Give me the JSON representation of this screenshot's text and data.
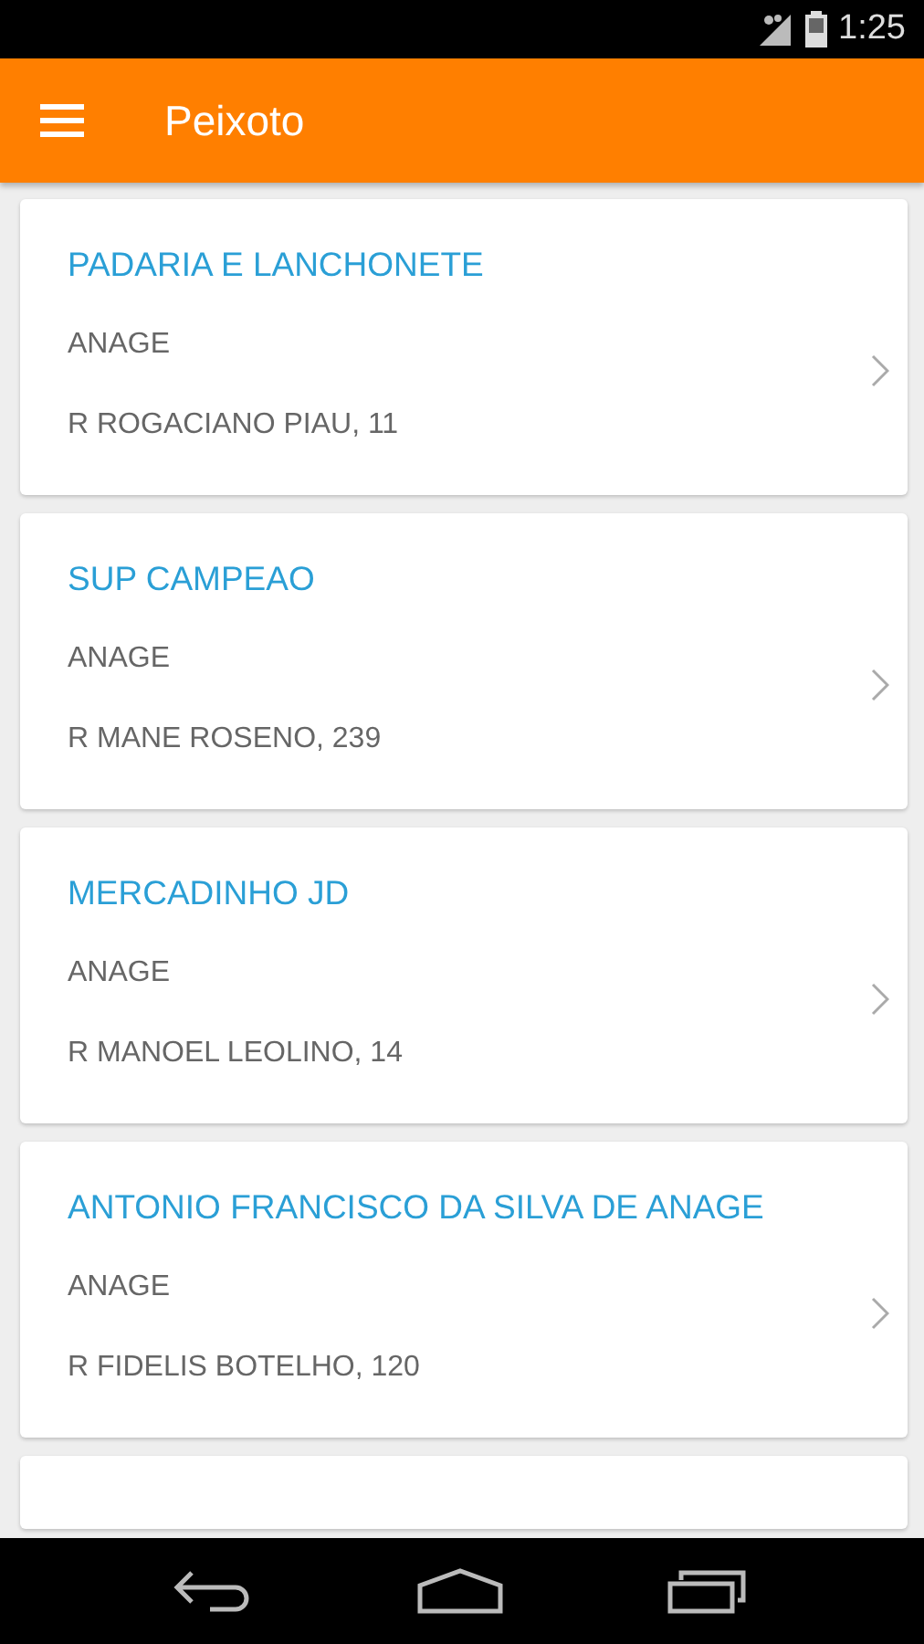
{
  "status_bar": {
    "time": "1:25"
  },
  "toolbar": {
    "title": "Peixoto"
  },
  "stores": [
    {
      "name": "PADARIA E LANCHONETE",
      "city": "ANAGE",
      "address": "R ROGACIANO PIAU, 11"
    },
    {
      "name": "SUP CAMPEAO",
      "city": "ANAGE",
      "address": "R  MANE ROSENO, 239"
    },
    {
      "name": "MERCADINHO JD",
      "city": "ANAGE",
      "address": "R MANOEL LEOLINO, 14"
    },
    {
      "name": "ANTONIO FRANCISCO DA SILVA DE ANAGE",
      "city": "ANAGE",
      "address": "R FIDELIS BOTELHO, 120"
    }
  ]
}
